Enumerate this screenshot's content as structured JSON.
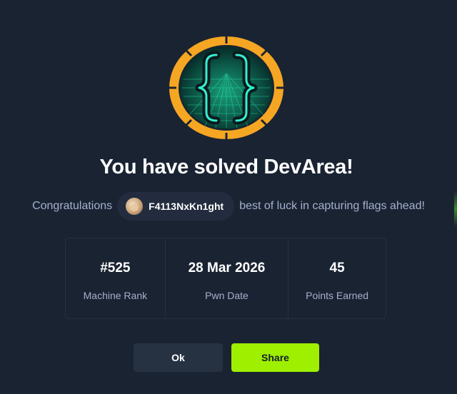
{
  "modal": {
    "title": "You have solved DevArea!",
    "congrats_prefix": "Congratulations",
    "username": "F4113NxKn1ght",
    "congrats_suffix": "best of luck in capturing flags ahead!",
    "badge_icon": "curly-braces-logo",
    "stats": [
      {
        "value": "#525",
        "label": "Machine Rank"
      },
      {
        "value": "28 Mar 2026",
        "label": "Pwn Date"
      },
      {
        "value": "45",
        "label": "Points Earned"
      }
    ],
    "buttons": {
      "ok_label": "Ok",
      "share_label": "Share"
    }
  },
  "colors": {
    "background": "#1a2332",
    "accent_green": "#9fef00",
    "badge_ring": "#f5a623",
    "badge_grid": "#1fd39a",
    "muted_text": "#a4b1cd"
  }
}
